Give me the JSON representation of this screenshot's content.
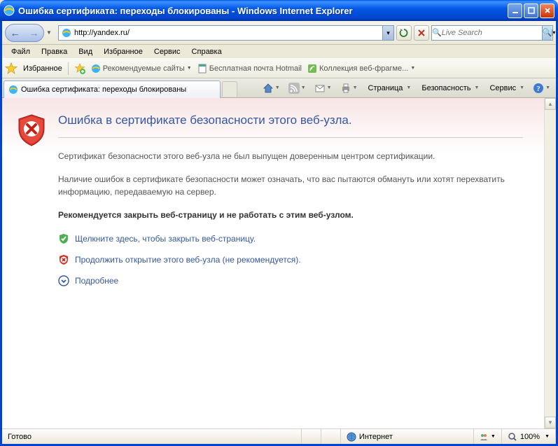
{
  "titlebar": {
    "title": "Ошибка сертификата: переходы блокированы - Windows Internet Explorer"
  },
  "nav": {
    "url": "http://yandex.ru/",
    "search_placeholder": "Live Search"
  },
  "menu": {
    "file": "Файл",
    "edit": "Правка",
    "view": "Вид",
    "favorites": "Избранное",
    "tools": "Сервис",
    "help": "Справка"
  },
  "favbar": {
    "favorites": "Избранное",
    "suggested": "Рекомендуемые сайты",
    "hotmail": "Бесплатная почта Hotmail",
    "webfrag": "Коллекция веб-фрагме..."
  },
  "tabs": {
    "tab1": "Ошибка сертификата: переходы блокированы"
  },
  "toolbar": {
    "page": "Страница",
    "safety": "Безопасность",
    "service": "Сервис"
  },
  "page": {
    "heading": "Ошибка в сертификате безопасности этого веб-узла.",
    "p1": "Сертификат безопасности этого веб-узла не был выпущен доверенным центром сертификации.",
    "p2": "Наличие ошибок в сертификате безопасности может означать, что вас пытаются обмануть или хотят перехватить информацию, передаваемую на сервер.",
    "p3": "Рекомендуется закрыть веб-страницу и не работать с этим веб-узлом.",
    "close_link": "Щелкните здесь, чтобы закрыть веб-страницу.",
    "continue_link": "Продолжить открытие этого веб-узла (не рекомендуется).",
    "more_link": "Подробнее"
  },
  "status": {
    "ready": "Готово",
    "zone": "Интернет",
    "protected": "",
    "zoom": "100%"
  }
}
